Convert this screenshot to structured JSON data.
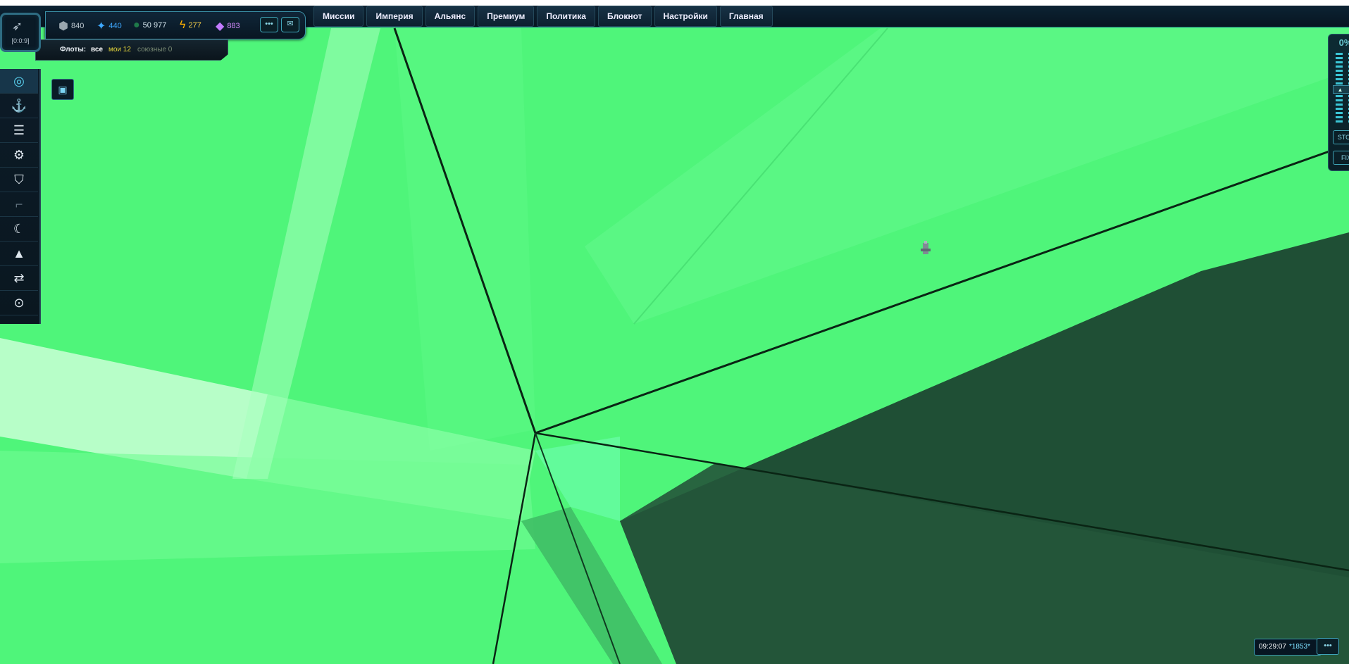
{
  "colors": {
    "space": "#4ff57a",
    "accent": "#3fa5b8",
    "dark_sector": "#1e4d33"
  },
  "coords": {
    "label": "[0:0:9]",
    "ship_icon": "rocket-icon"
  },
  "resources": [
    {
      "name": "metal",
      "icon": "rock-icon",
      "value": "840",
      "color": "#c0cbd3"
    },
    {
      "name": "crystal",
      "icon": "crystal-icon",
      "value": "440",
      "color": "#3ea8ff"
    },
    {
      "name": "deuterium",
      "icon": "drop-icon",
      "value": "50 977",
      "color": "#d6e6ee"
    },
    {
      "name": "energy",
      "icon": "lightning-icon",
      "value": "277",
      "color": "#ffd54a"
    },
    {
      "name": "premium",
      "icon": "gem-icon",
      "value": "883",
      "color": "#d48cff"
    }
  ],
  "fleets": {
    "label": "Флоты:",
    "all": "все",
    "mine": "мои 12",
    "allied": "союзные 0"
  },
  "menu": [
    "Миссии",
    "Империя",
    "Альянс",
    "Премиум",
    "Политика",
    "Блокнот",
    "Настройки",
    "Главная"
  ],
  "sidebar_icons": [
    "planet-orbit-icon",
    "crane-icon",
    "stack-icon",
    "gear-icon",
    "shield-icon",
    "gun-icon",
    "moon-orbit-icon",
    "rocket-icon",
    "transfer-icon",
    "galaxy-icon"
  ],
  "right_panel": {
    "percent": "0%",
    "stop": "STOP",
    "fix": "FIX"
  },
  "status": {
    "time": "09:29:07",
    "points": "*1853*",
    "chat": "•••"
  }
}
